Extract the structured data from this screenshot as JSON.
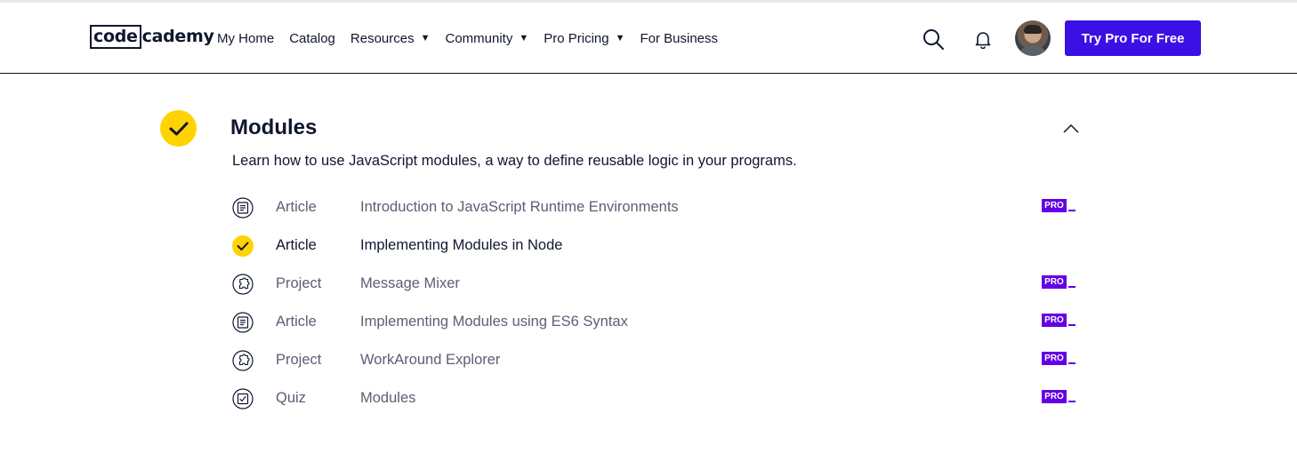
{
  "brand": {
    "logo_code": "code",
    "logo_rest": "cademy",
    "accent": "#3a10e5",
    "check_yellow": "#ffd300",
    "pro_purple": "#6400e4"
  },
  "nav": {
    "links": [
      {
        "label": "My Home",
        "caret": false
      },
      {
        "label": "Catalog",
        "caret": false
      },
      {
        "label": "Resources",
        "caret": true
      },
      {
        "label": "Community",
        "caret": true
      },
      {
        "label": "Pro Pricing",
        "caret": true
      },
      {
        "label": "For Business",
        "caret": false
      }
    ],
    "caret_glyph": "▼",
    "cta_label": "Try Pro For Free",
    "icons": [
      "search-icon",
      "bell-icon",
      "avatar"
    ]
  },
  "module": {
    "title": "Modules",
    "description": "Learn how to use JavaScript modules, a way to define reusable logic in your programs.",
    "completed": true,
    "expanded": true,
    "items": [
      {
        "type": "Article",
        "name": "Introduction to JavaScript Runtime Environments",
        "icon": "article-icon",
        "completed": false,
        "pro": true
      },
      {
        "type": "Article",
        "name": "Implementing Modules in Node",
        "icon": "check-icon",
        "completed": true,
        "pro": false
      },
      {
        "type": "Project",
        "name": "Message Mixer",
        "icon": "project-icon",
        "completed": false,
        "pro": true
      },
      {
        "type": "Article",
        "name": "Implementing Modules using ES6 Syntax",
        "icon": "article-icon",
        "completed": false,
        "pro": true
      },
      {
        "type": "Project",
        "name": "WorkAround Explorer",
        "icon": "project-icon",
        "completed": false,
        "pro": true
      },
      {
        "type": "Quiz",
        "name": "Modules",
        "icon": "quiz-icon",
        "completed": false,
        "pro": true
      }
    ],
    "pro_label": "PRO"
  }
}
